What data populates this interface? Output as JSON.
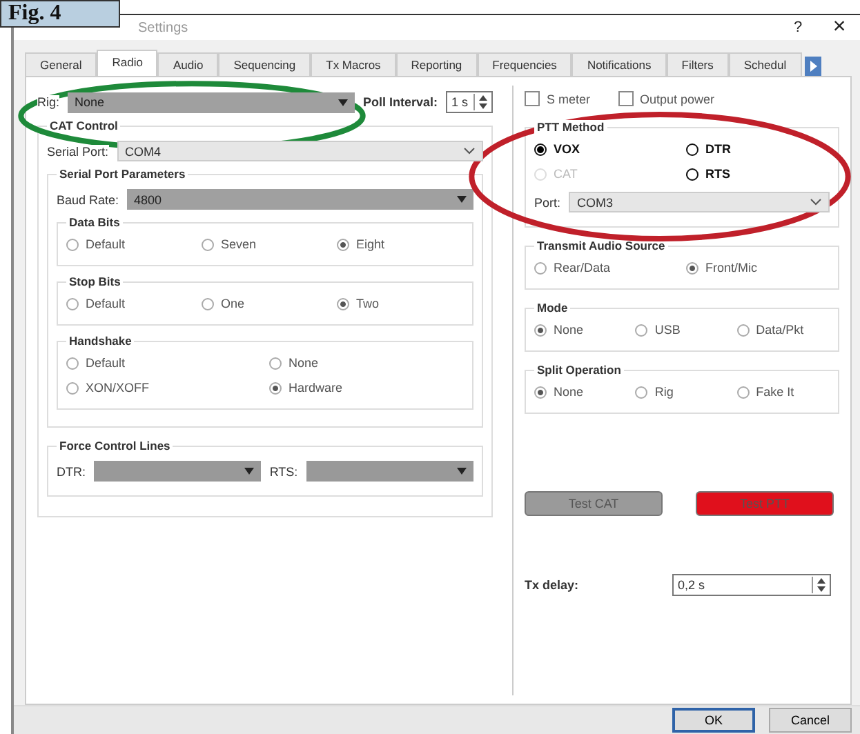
{
  "figure_label": "Fig. 4",
  "window": {
    "title": "Settings",
    "help": "?",
    "close": "×"
  },
  "tabs": [
    {
      "label": "General",
      "selected": false
    },
    {
      "label": "Radio",
      "selected": true
    },
    {
      "label": "Audio",
      "selected": false
    },
    {
      "label": "Sequencing",
      "selected": false
    },
    {
      "label": "Tx Macros",
      "selected": false
    },
    {
      "label": "Reporting",
      "selected": false
    },
    {
      "label": "Frequencies",
      "selected": false
    },
    {
      "label": "Notifications",
      "selected": false
    },
    {
      "label": "Filters",
      "selected": false
    },
    {
      "label": "Schedul",
      "selected": false
    }
  ],
  "rig": {
    "label": "Rig:",
    "value": "None"
  },
  "poll": {
    "label": "Poll Interval:",
    "value": "1 s"
  },
  "checkboxes": [
    {
      "label": "S meter",
      "checked": false
    },
    {
      "label": "Output power",
      "checked": false
    }
  ],
  "cat_control": {
    "title": "CAT Control",
    "serial_port": {
      "label": "Serial Port:",
      "value": "COM4"
    },
    "serial_params": {
      "title": "Serial Port Parameters",
      "baud": {
        "label": "Baud Rate:",
        "value": "4800"
      },
      "groups": [
        {
          "title": "Data Bits",
          "options": [
            {
              "label": "Default",
              "selected": false
            },
            {
              "label": "Seven",
              "selected": false
            },
            {
              "label": "Eight",
              "selected": true
            }
          ]
        },
        {
          "title": "Stop Bits",
          "options": [
            {
              "label": "Default",
              "selected": false
            },
            {
              "label": "One",
              "selected": false
            },
            {
              "label": "Two",
              "selected": true
            }
          ]
        },
        {
          "title": "Handshake",
          "options": [
            {
              "label": "Default",
              "selected": false
            },
            {
              "label": "None",
              "selected": false
            },
            {
              "label": "XON/XOFF",
              "selected": false
            },
            {
              "label": "Hardware",
              "selected": true
            }
          ]
        }
      ]
    },
    "force_lines": {
      "title": "Force Control Lines",
      "fields": [
        {
          "label": "DTR:"
        },
        {
          "label": "RTS:"
        }
      ]
    }
  },
  "ptt": {
    "title": "PTT Method",
    "options": [
      {
        "label": "VOX",
        "selected": true,
        "disabled": false
      },
      {
        "label": "DTR",
        "selected": false,
        "disabled": false
      },
      {
        "label": "CAT",
        "selected": false,
        "disabled": true
      },
      {
        "label": "RTS",
        "selected": false,
        "disabled": false
      }
    ],
    "port": {
      "label": "Port:",
      "value": "COM3"
    }
  },
  "right_groups": [
    {
      "title": "Transmit Audio Source",
      "options": [
        {
          "label": "Rear/Data",
          "selected": false
        },
        {
          "label": "Front/Mic",
          "selected": true
        }
      ]
    },
    {
      "title": "Mode",
      "options": [
        {
          "label": "None",
          "selected": true
        },
        {
          "label": "USB",
          "selected": false
        },
        {
          "label": "Data/Pkt",
          "selected": false
        }
      ]
    },
    {
      "title": "Split Operation",
      "options": [
        {
          "label": "None",
          "selected": true
        },
        {
          "label": "Rig",
          "selected": false
        },
        {
          "label": "Fake It",
          "selected": false
        }
      ]
    }
  ],
  "test_buttons": [
    {
      "label": "Test CAT",
      "color": "#9a9a9a"
    },
    {
      "label": "Test PTT",
      "color": "#e0101c"
    }
  ],
  "tx_delay": {
    "label": "Tx delay:",
    "value": "0,2 s"
  },
  "footer_buttons": [
    {
      "label": "OK",
      "kind": "default"
    },
    {
      "label": "Cancel",
      "kind": "normal"
    }
  ],
  "annotations": [
    {
      "color": "#1e8a3a"
    },
    {
      "color": "#c0202a"
    }
  ]
}
